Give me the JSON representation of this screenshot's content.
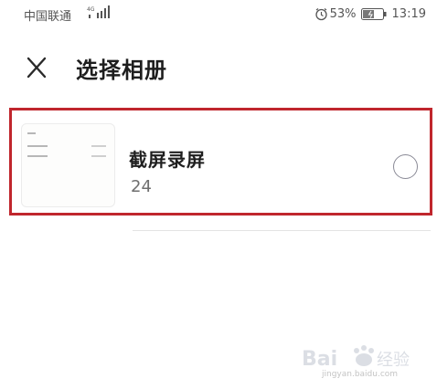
{
  "status_bar": {
    "carrier": "中国联通",
    "network_type": "4G",
    "battery_percent": "53%",
    "time": "13:19",
    "icons": [
      "signal-icon",
      "alarm-icon",
      "battery-icon"
    ]
  },
  "header": {
    "title": "选择相册",
    "close_icon": "close-icon"
  },
  "albums": [
    {
      "name": "截屏录屏",
      "count": "24",
      "selected": false
    }
  ],
  "colors": {
    "highlight_border": "#c0262d",
    "radio_border": "#8a8a96",
    "divider": "#e3e3e3"
  },
  "watermark": {
    "url": "jingyan.baidu.com"
  }
}
